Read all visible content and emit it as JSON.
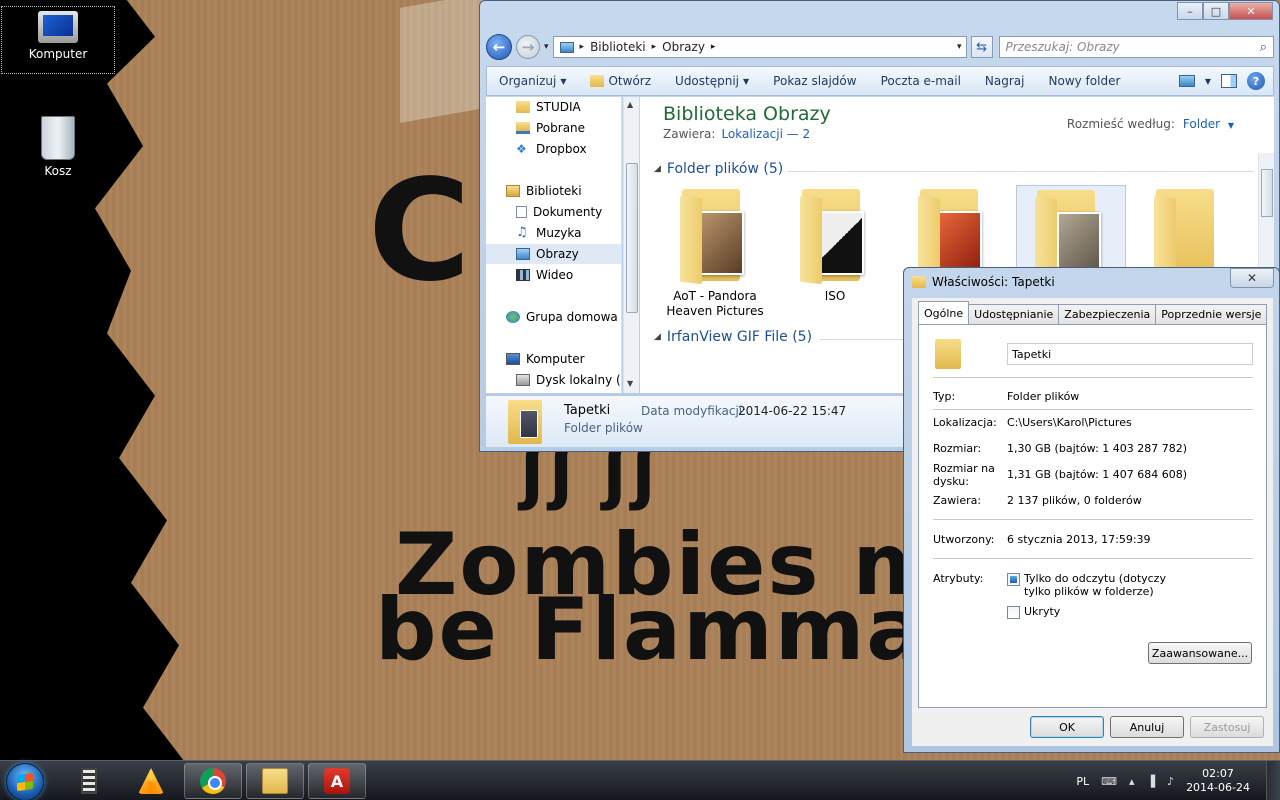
{
  "desktop": {
    "wallpaper_text": {
      "top": "C",
      "middle": "ʃʃ ʃʃ",
      "line1": "Zombies m",
      "line2": "be Flammal"
    },
    "icons": [
      {
        "label": "Komputer",
        "icon": "computer-icon"
      },
      {
        "label": "Kosz",
        "icon": "recycle-bin-icon"
      }
    ]
  },
  "explorer": {
    "caption_buttons": {
      "minimize": "–",
      "maximize": "□",
      "close": "✕"
    },
    "nav": {
      "back": "←",
      "forward": "→",
      "history": "▾"
    },
    "address": {
      "crumb1": "Biblioteki",
      "crumb2": "Obrazy",
      "sep": "▸",
      "dropdown": "▾"
    },
    "refresh": "⇆",
    "search": {
      "placeholder": "Przeszukaj: Obrazy",
      "icon": "⌕"
    },
    "commands": {
      "organize": "Organizuj",
      "open": "Otwórz",
      "share": "Udostępnij",
      "slideshow": "Pokaz slajdów",
      "email": "Poczta e-mail",
      "burn": "Nagraj",
      "new_folder": "Nowy folder",
      "dropdown": "▼",
      "help": "?"
    },
    "nav_pane": {
      "items": [
        {
          "label": "STUDIA",
          "icon": "folder"
        },
        {
          "label": "Pobrane",
          "icon": "dl"
        },
        {
          "label": "Dropbox",
          "icon": "dropbox"
        },
        {
          "label": "Biblioteki",
          "icon": "lib"
        },
        {
          "label": "Dokumenty",
          "icon": "doc"
        },
        {
          "label": "Muzyka",
          "icon": "music"
        },
        {
          "label": "Obrazy",
          "icon": "pic",
          "selected": true
        },
        {
          "label": "Wideo",
          "icon": "vid"
        },
        {
          "label": "Grupa domowa",
          "icon": "home"
        },
        {
          "label": "Komputer",
          "icon": "pc"
        },
        {
          "label": "Dysk lokalny (C:)",
          "icon": "disk"
        }
      ],
      "scroll_up": "▲",
      "scroll_down": "▼"
    },
    "library": {
      "title": "Biblioteka Obrazy",
      "contains_label": "Zawiera:",
      "contains_link": "Lokalizacji — 2",
      "arrange_label": "Rozmieść według:",
      "arrange_value": "Folder",
      "arrange_dropdown": "▼"
    },
    "groups": [
      {
        "title": "Folder plików (5)",
        "collapse": "◢"
      },
      {
        "title": "IrfanView GIF File (5)",
        "collapse": "◢"
      }
    ],
    "folders": [
      {
        "name": "AoT - Pandora Heaven Pictures",
        "photo_color": "#7a5a3e"
      },
      {
        "name": "ISO",
        "photo_color": "#1a1a1a"
      },
      {
        "name": "",
        "photo_color": "#c2351a"
      },
      {
        "name": "",
        "photo_color": "#8b8070"
      },
      {
        "name": "",
        "photo_color": "#e8c25f"
      }
    ],
    "details": {
      "name": "Tapetki",
      "type": "Folder plików",
      "modified_label": "Data modyfikacji:",
      "modified_value": "2014-06-22 15:47"
    }
  },
  "properties": {
    "title": "Właściwości: Tapetki",
    "close": "✕",
    "tabs": [
      "Ogólne",
      "Udostępnianie",
      "Zabezpieczenia",
      "Poprzednie wersje"
    ],
    "folder_name": "Tapetki",
    "rows": {
      "type_label": "Typ:",
      "type_value": "Folder plików",
      "location_label": "Lokalizacja:",
      "location_value": "C:\\Users\\Karol\\Pictures",
      "size_label": "Rozmiar:",
      "size_value": "1,30 GB (bajtów: 1 403 287 782)",
      "disk_size_label": "Rozmiar na dysku:",
      "disk_size_value": "1,31 GB (bajtów: 1 407 684 608)",
      "contains_label": "Zawiera:",
      "contains_value": "2 137 plików, 0 folderów",
      "created_label": "Utworzony:",
      "created_value": "6 stycznia 2013, 17:59:39",
      "attributes_label": "Atrybuty:",
      "readonly_label": "Tylko do odczytu (dotyczy tylko plików w folderze)",
      "hidden_label": "Ukryty"
    },
    "advanced_button": "Zaawansowane...",
    "ok": "OK",
    "cancel": "Anuluj",
    "apply": "Zastosuj"
  },
  "taskbar": {
    "lang": "PL",
    "tray_icons": [
      "⌨",
      "▴",
      "▐",
      "♪"
    ],
    "time": "02:07",
    "date": "2014-06-24",
    "acrobat_glyph": "A"
  }
}
